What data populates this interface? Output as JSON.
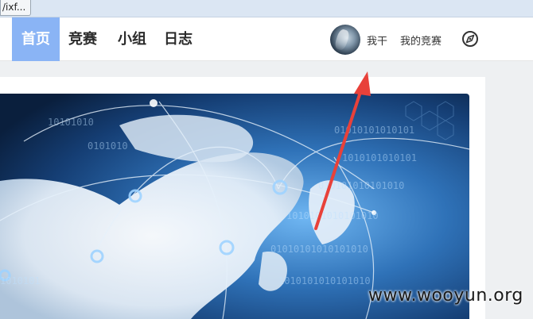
{
  "browser": {
    "url_fragment": "/ixf..."
  },
  "nav": {
    "items": [
      {
        "label": "首页",
        "active": true
      },
      {
        "label": "竞赛",
        "active": false
      },
      {
        "label": "小组",
        "active": false
      },
      {
        "label": "日志",
        "active": false
      }
    ],
    "active_color": "#8ab4f5"
  },
  "user": {
    "name": "我干",
    "my_contests": "我的竞赛",
    "explore_icon": "compass-icon"
  },
  "banner": {
    "image": "world-map-network-globe"
  },
  "annotation": {
    "color": "#e8413a",
    "type": "arrow"
  },
  "watermark": "www.wooyun.org"
}
